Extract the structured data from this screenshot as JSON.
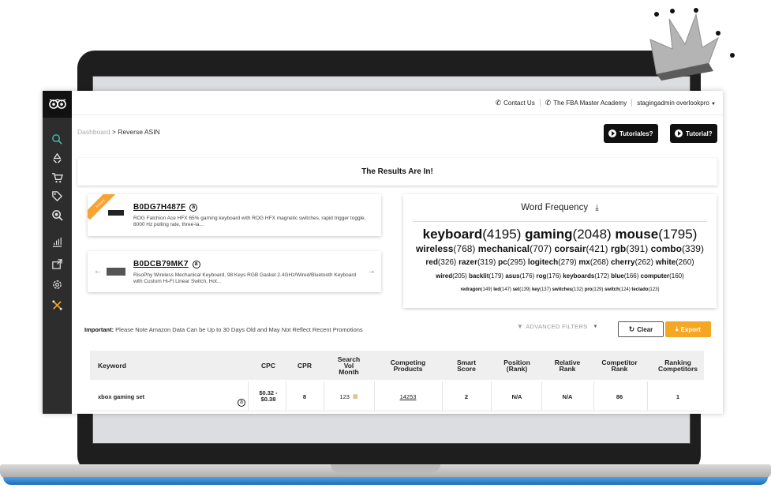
{
  "topbar": {
    "contact": "Contact Us",
    "academy": "The FBA Master Academy",
    "user": "stagingadmin overlookpro"
  },
  "breadcrumb": {
    "root": "Dashboard",
    "separator": ">",
    "current": "Reverse ASIN"
  },
  "buttons": {
    "tutoriales": "Tutoriales?",
    "tutorial": "Tutorial?",
    "clear": "Clear",
    "export": "Export"
  },
  "results": {
    "title": "The Results Are In!"
  },
  "asins": [
    {
      "code": "B0DG7H487F",
      "amazon_badge": "a",
      "ribbon": "Primary",
      "desc": "ROG Falchion Ace HFX 65% gaming keyboard with ROG HFX magnetic switches, rapid trigger toggle, 8000 Hz polling rate, three-la..."
    },
    {
      "code": "B0DCB79MK7",
      "amazon_badge": "a",
      "desc": "RisoPhy Wireless Mechanical Keyboard, 98 Keys RGB Gasket 2.4GHz/Wired/Bluetooth Keyboard with Custom Hi-Fi Linear Switch, Hot..."
    }
  ],
  "word_frequency": {
    "title": "Word Frequency",
    "row1": [
      {
        "w": "keyboard",
        "c": "(4195)"
      },
      {
        "w": "gaming",
        "c": "(2048)"
      },
      {
        "w": "mouse",
        "c": "(1795)"
      }
    ],
    "row2": [
      {
        "w": "wireless",
        "c": "(768)"
      },
      {
        "w": "mechanical",
        "c": "(707)"
      },
      {
        "w": "corsair",
        "c": "(421)"
      },
      {
        "w": "rgb",
        "c": "(391)"
      },
      {
        "w": "combo",
        "c": "(339)"
      }
    ],
    "row3": [
      {
        "w": "red",
        "c": "(326)"
      },
      {
        "w": "razer",
        "c": "(319)"
      },
      {
        "w": "pc",
        "c": "(295)"
      },
      {
        "w": "logitech",
        "c": "(279)"
      },
      {
        "w": "mx",
        "c": "(268)"
      },
      {
        "w": "cherry",
        "c": "(262)"
      },
      {
        "w": "white",
        "c": "(260)"
      }
    ],
    "row4": [
      {
        "w": "wired",
        "c": "(205)"
      },
      {
        "w": "backlit",
        "c": "(179)"
      },
      {
        "w": "asus",
        "c": "(176)"
      },
      {
        "w": "rog",
        "c": "(176)"
      },
      {
        "w": "keyboards",
        "c": "(172)"
      },
      {
        "w": "blue",
        "c": "(166)"
      },
      {
        "w": "computer",
        "c": "(160)"
      }
    ],
    "row5": [
      {
        "w": "redragon",
        "c": "(149)"
      },
      {
        "w": "led",
        "c": "(147)"
      },
      {
        "w": "set",
        "c": "(139)"
      },
      {
        "w": "key",
        "c": "(137)"
      },
      {
        "w": "switches",
        "c": "(132)"
      },
      {
        "w": "pro",
        "c": "(129)"
      },
      {
        "w": "switch",
        "c": "(124)"
      },
      {
        "w": "teclado",
        "c": "(123)"
      }
    ]
  },
  "notice": {
    "label": "Important:",
    "text": " Please Note Amazon Data Can be Up to 30 Days Old and May Not Reflect Recent Promotions"
  },
  "filters": {
    "label": "ADVANCED FILTERS"
  },
  "table": {
    "headers": {
      "keyword": "Keyword",
      "cpc": "CPC",
      "cpr": "CPR",
      "search_vol_1": "Search",
      "search_vol_2": "Vol",
      "search_vol_3": "Month",
      "competing_1": "Competing",
      "competing_2": "Products",
      "smart_1": "Smart",
      "smart_2": "Score",
      "position_1": "Position",
      "position_2": "(Rank)",
      "relative_1": "Relative",
      "relative_2": "Rank",
      "competitor_1": "Competitor",
      "competitor_2": "Rank",
      "ranking_1": "Ranking",
      "ranking_2": "Competitors"
    },
    "row": {
      "keyword": "xbox gaming set",
      "amazon_badge": "a",
      "cpc_1": "$0.32 -",
      "cpc_2": "$0.38",
      "cpr": "8",
      "search_vol": "123",
      "competing": "14253",
      "smart": "2",
      "position": "N/A",
      "relative": "N/A",
      "competitor": "86",
      "ranking": "1"
    }
  },
  "colors": {
    "accent": "#f5a623",
    "sidebar": "#2d2d2d",
    "active_icon": "#3fb8a8"
  }
}
